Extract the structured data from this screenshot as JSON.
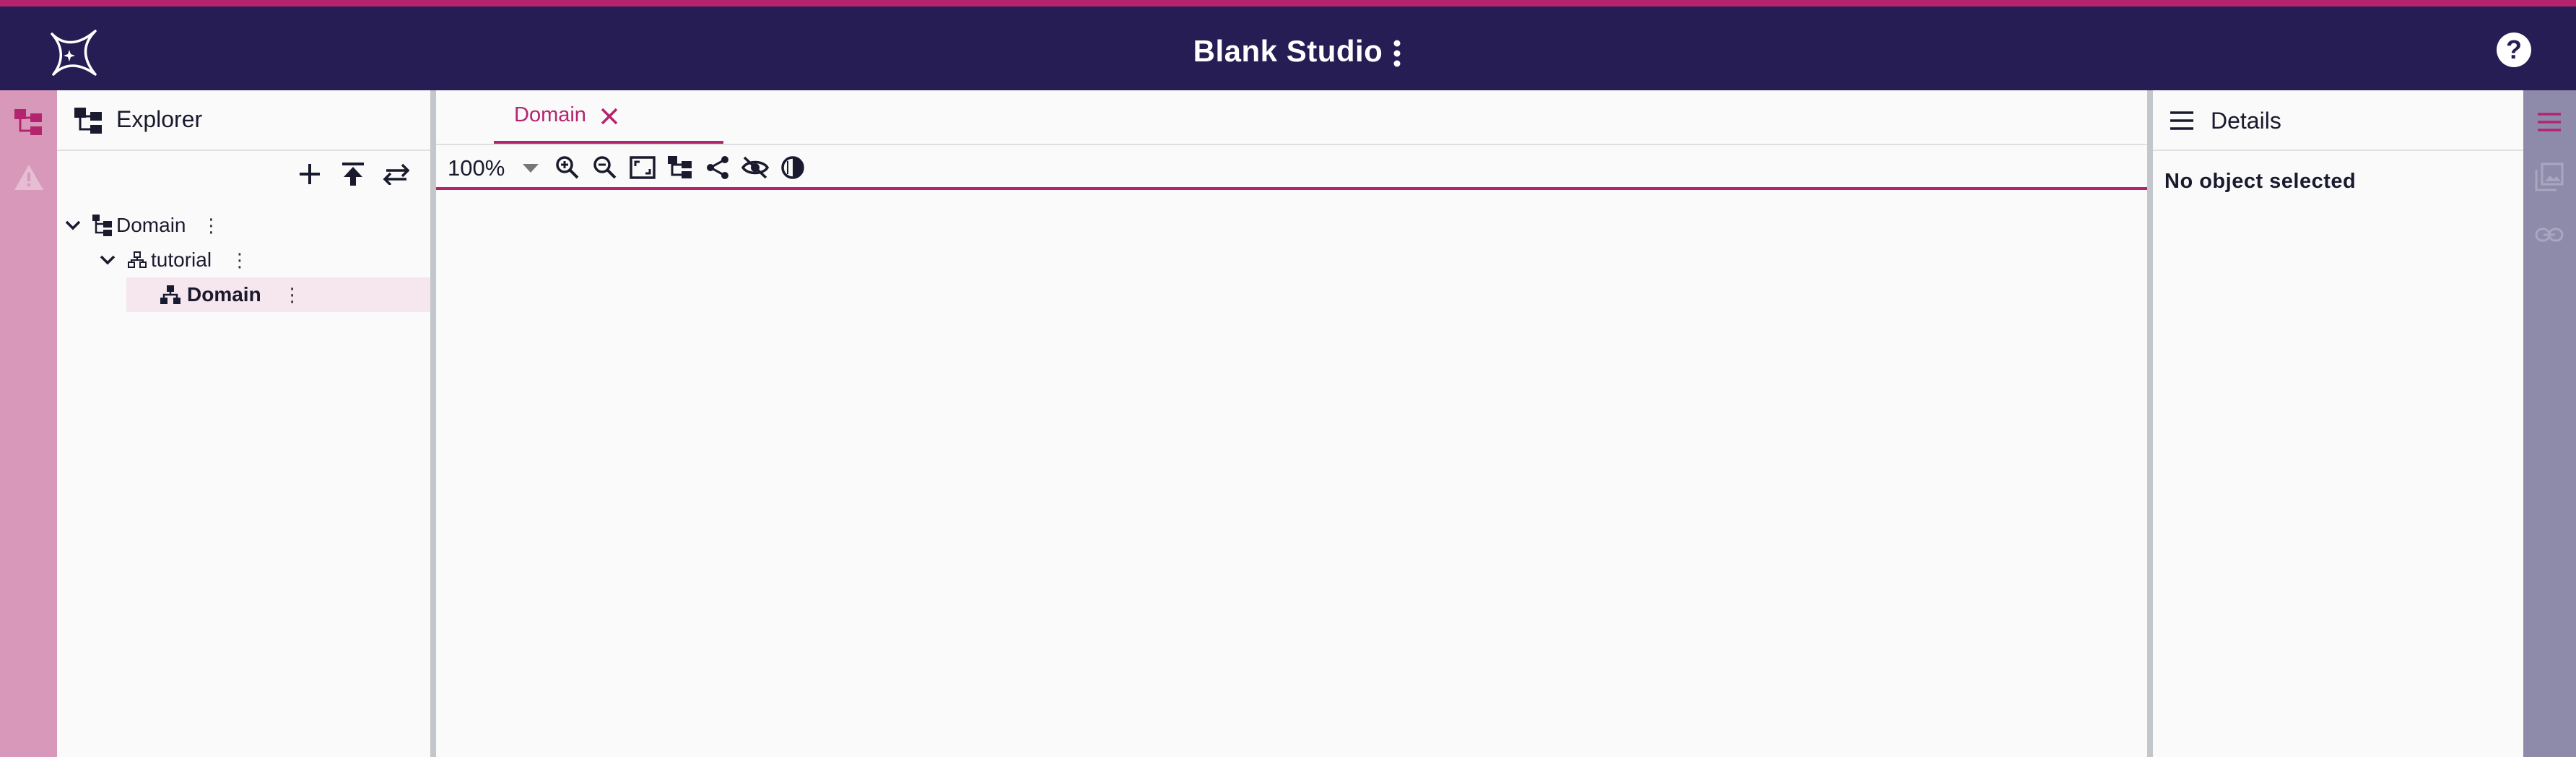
{
  "app": {
    "title": "Blank Studio"
  },
  "explorer": {
    "title": "Explorer",
    "tree": [
      {
        "label": "Domain",
        "level": 0,
        "expanded": true,
        "selected": false
      },
      {
        "label": "tutorial",
        "level": 1,
        "expanded": true,
        "selected": false
      },
      {
        "label": "Domain",
        "level": 2,
        "selected": true
      }
    ]
  },
  "editor": {
    "tab_label": "Domain",
    "zoom": "100%"
  },
  "details": {
    "title": "Details",
    "empty_text": "No object selected"
  },
  "colors": {
    "accent": "#b4246e",
    "header": "#261d55",
    "left_rail": "#d898ba",
    "right_rail": "#8e8aaa",
    "selection": "#f6e6ee"
  }
}
